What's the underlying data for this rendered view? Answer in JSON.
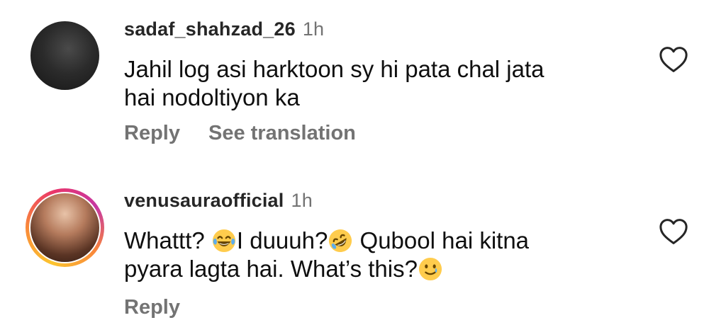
{
  "comments": [
    {
      "username": "sadaf_shahzad_26",
      "time": "1h",
      "text_lines": [
        "Jahil log asi harktoon sy hi pata chal jata",
        "hai nodoltiyon ka"
      ],
      "actions": {
        "reply": "Reply",
        "translate": "See translation"
      },
      "avatar_icon": "user-avatar-dark",
      "like_icon": "heart-outline-icon"
    },
    {
      "username": "venusauraofficial",
      "time": "1h",
      "text_segments": {
        "a": "Whattt? ",
        "b": "I duuuh?",
        "c": " Qubool hai kitna",
        "d": "pyara lagta hai. What’s this?"
      },
      "emojis": [
        "face-with-tears-of-joy",
        "rolling-on-floor-laughing",
        "smiling-face-with-tear"
      ],
      "actions": {
        "reply": "Reply"
      },
      "avatar_icon": "user-avatar-story-ring",
      "like_icon": "heart-outline-icon"
    }
  ]
}
